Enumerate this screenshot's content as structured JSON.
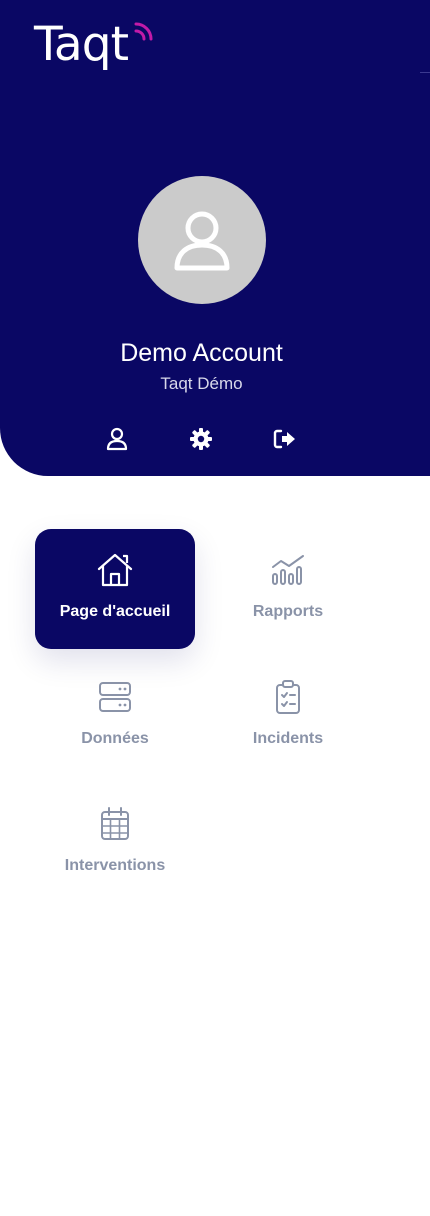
{
  "brand": {
    "logo_text": "Taqt",
    "accent_color": "#c21aa8",
    "header_color": "#0a0764"
  },
  "profile": {
    "name": "Demo Account",
    "organization": "Taqt Démo",
    "avatar_icon": "user-silhouette-icon"
  },
  "actions": [
    {
      "icon": "user-icon"
    },
    {
      "icon": "gear-icon"
    },
    {
      "icon": "logout-icon"
    }
  ],
  "nav": {
    "items": [
      {
        "label": "Page d'accueil",
        "icon": "home-icon",
        "active": true
      },
      {
        "label": "Rapports",
        "icon": "chart-icon",
        "active": false
      },
      {
        "label": "Données",
        "icon": "server-icon",
        "active": false
      },
      {
        "label": "Incidents",
        "icon": "clipboard-check-icon",
        "active": false
      },
      {
        "label": "Interventions",
        "icon": "calendar-icon",
        "active": false
      }
    ]
  }
}
